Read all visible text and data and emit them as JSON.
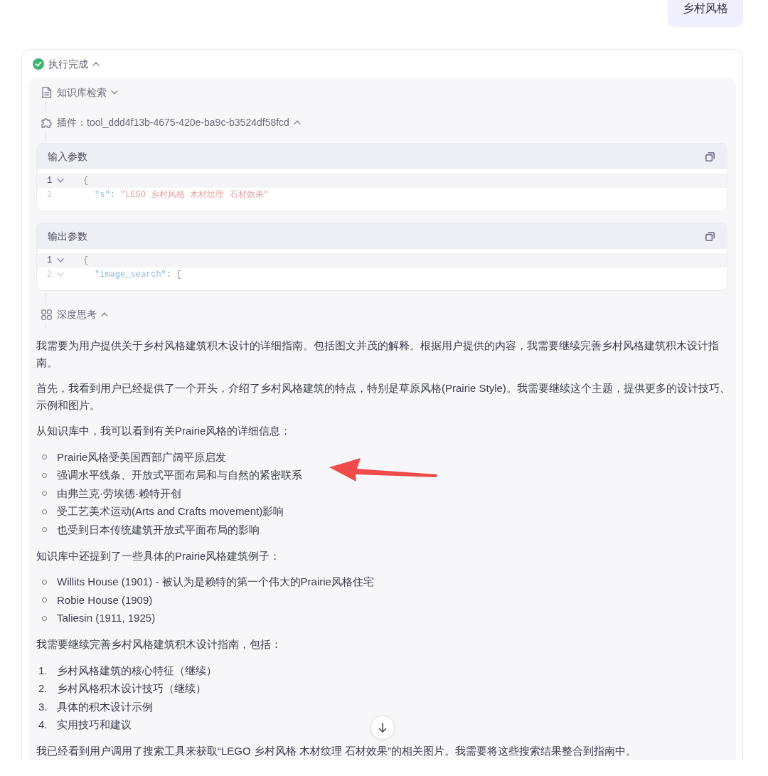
{
  "user_message": {
    "text": "乡村风格"
  },
  "run": {
    "status": {
      "label": "执行完成",
      "completed": true
    },
    "expanded": true,
    "steps": [
      {
        "kind": "knowledge",
        "label": "知识库检索",
        "expanded": false
      },
      {
        "kind": "plugin",
        "label": "插件：tool_ddd4f13b-4675-420e-ba9c-b3524df58fcd",
        "expanded": true,
        "panels": [
          {
            "title": "输入参数",
            "lines": [
              {
                "number": "1",
                "foldable": true,
                "active": true,
                "tokens": [
                  {
                    "kind": "punct",
                    "text": "{"
                  }
                ],
                "children": [
                  {
                    "number": "2",
                    "foldable": false,
                    "active": false,
                    "tokens": [
                      {
                        "kind": "key",
                        "text": "\"s\""
                      },
                      {
                        "kind": "punct",
                        "text": ": "
                      },
                      {
                        "kind": "string",
                        "text": "\"LEGO 乡村风格 木材纹理 石材效果\""
                      }
                    ]
                  }
                ]
              }
            ]
          },
          {
            "title": "输出参数",
            "lines": [
              {
                "number": "1",
                "foldable": true,
                "active": true,
                "tokens": [
                  {
                    "kind": "punct",
                    "text": "{"
                  }
                ],
                "children": [
                  {
                    "number": "2",
                    "foldable": true,
                    "active": false,
                    "tokens": [
                      {
                        "kind": "key",
                        "text": "\"image_search\""
                      },
                      {
                        "kind": "punct",
                        "text": ": ["
                      }
                    ]
                  }
                ]
              }
            ]
          }
        ]
      },
      {
        "kind": "thinking",
        "label": "深度思考",
        "expanded": true,
        "blocks": [
          {
            "kind": "paragraph",
            "text": "我需要为用户提供关于乡村风格建筑积木设计的详细指南。包括图文并茂的解释。根据用户提供的内容，我需要继续完善乡村风格建筑积木设计指南。"
          },
          {
            "kind": "paragraph",
            "text": "首先，我看到用户已经提供了一个开头，介绍了乡村风格建筑的特点，特别是草原风格(Prairie Style)。我需要继续这个主题，提供更多的设计技巧、示例和图片。"
          },
          {
            "kind": "paragraph",
            "text": "从知识库中，我可以看到有关Prairie风格的详细信息："
          },
          {
            "kind": "bullets",
            "items": [
              "Prairie风格受美国西部广阔平原启发",
              "强调水平线条、开放式平面布局和与自然的紧密联系",
              "由弗兰克·劳埃德·赖特开创",
              "受工艺美术运动(Arts and Crafts movement)影响",
              "也受到日本传统建筑开放式平面布局的影响"
            ]
          },
          {
            "kind": "paragraph",
            "text": "知识库中还提到了一些具体的Prairie风格建筑例子："
          },
          {
            "kind": "bullets",
            "items": [
              "Willits House (1901) - 被认为是赖特的第一个伟大的Prairie风格住宅",
              "Robie House (1909)",
              "Taliesin (1911, 1925)"
            ]
          },
          {
            "kind": "paragraph",
            "text": "我需要继续完善乡村风格建筑积木设计指南，包括："
          },
          {
            "kind": "numbered",
            "items": [
              {
                "number": "1.",
                "text": "乡村风格建筑的核心特征（继续）"
              },
              {
                "number": "2.",
                "text": "乡村风格积木设计技巧（继续）"
              },
              {
                "number": "3.",
                "text": "具体的积木设计示例"
              },
              {
                "number": "4.",
                "text": "实用技巧和建议"
              }
            ]
          },
          {
            "kind": "paragraph",
            "text": "我已经看到用户调用了搜索工具来获取“LEGO 乡村风格 木材纹理 石材效果”的相关图片。我需要将这些搜索结果整合到指南中。"
          }
        ]
      }
    ]
  },
  "scroll_down_button": true,
  "annotations": [
    {
      "kind": "arrow"
    }
  ]
}
